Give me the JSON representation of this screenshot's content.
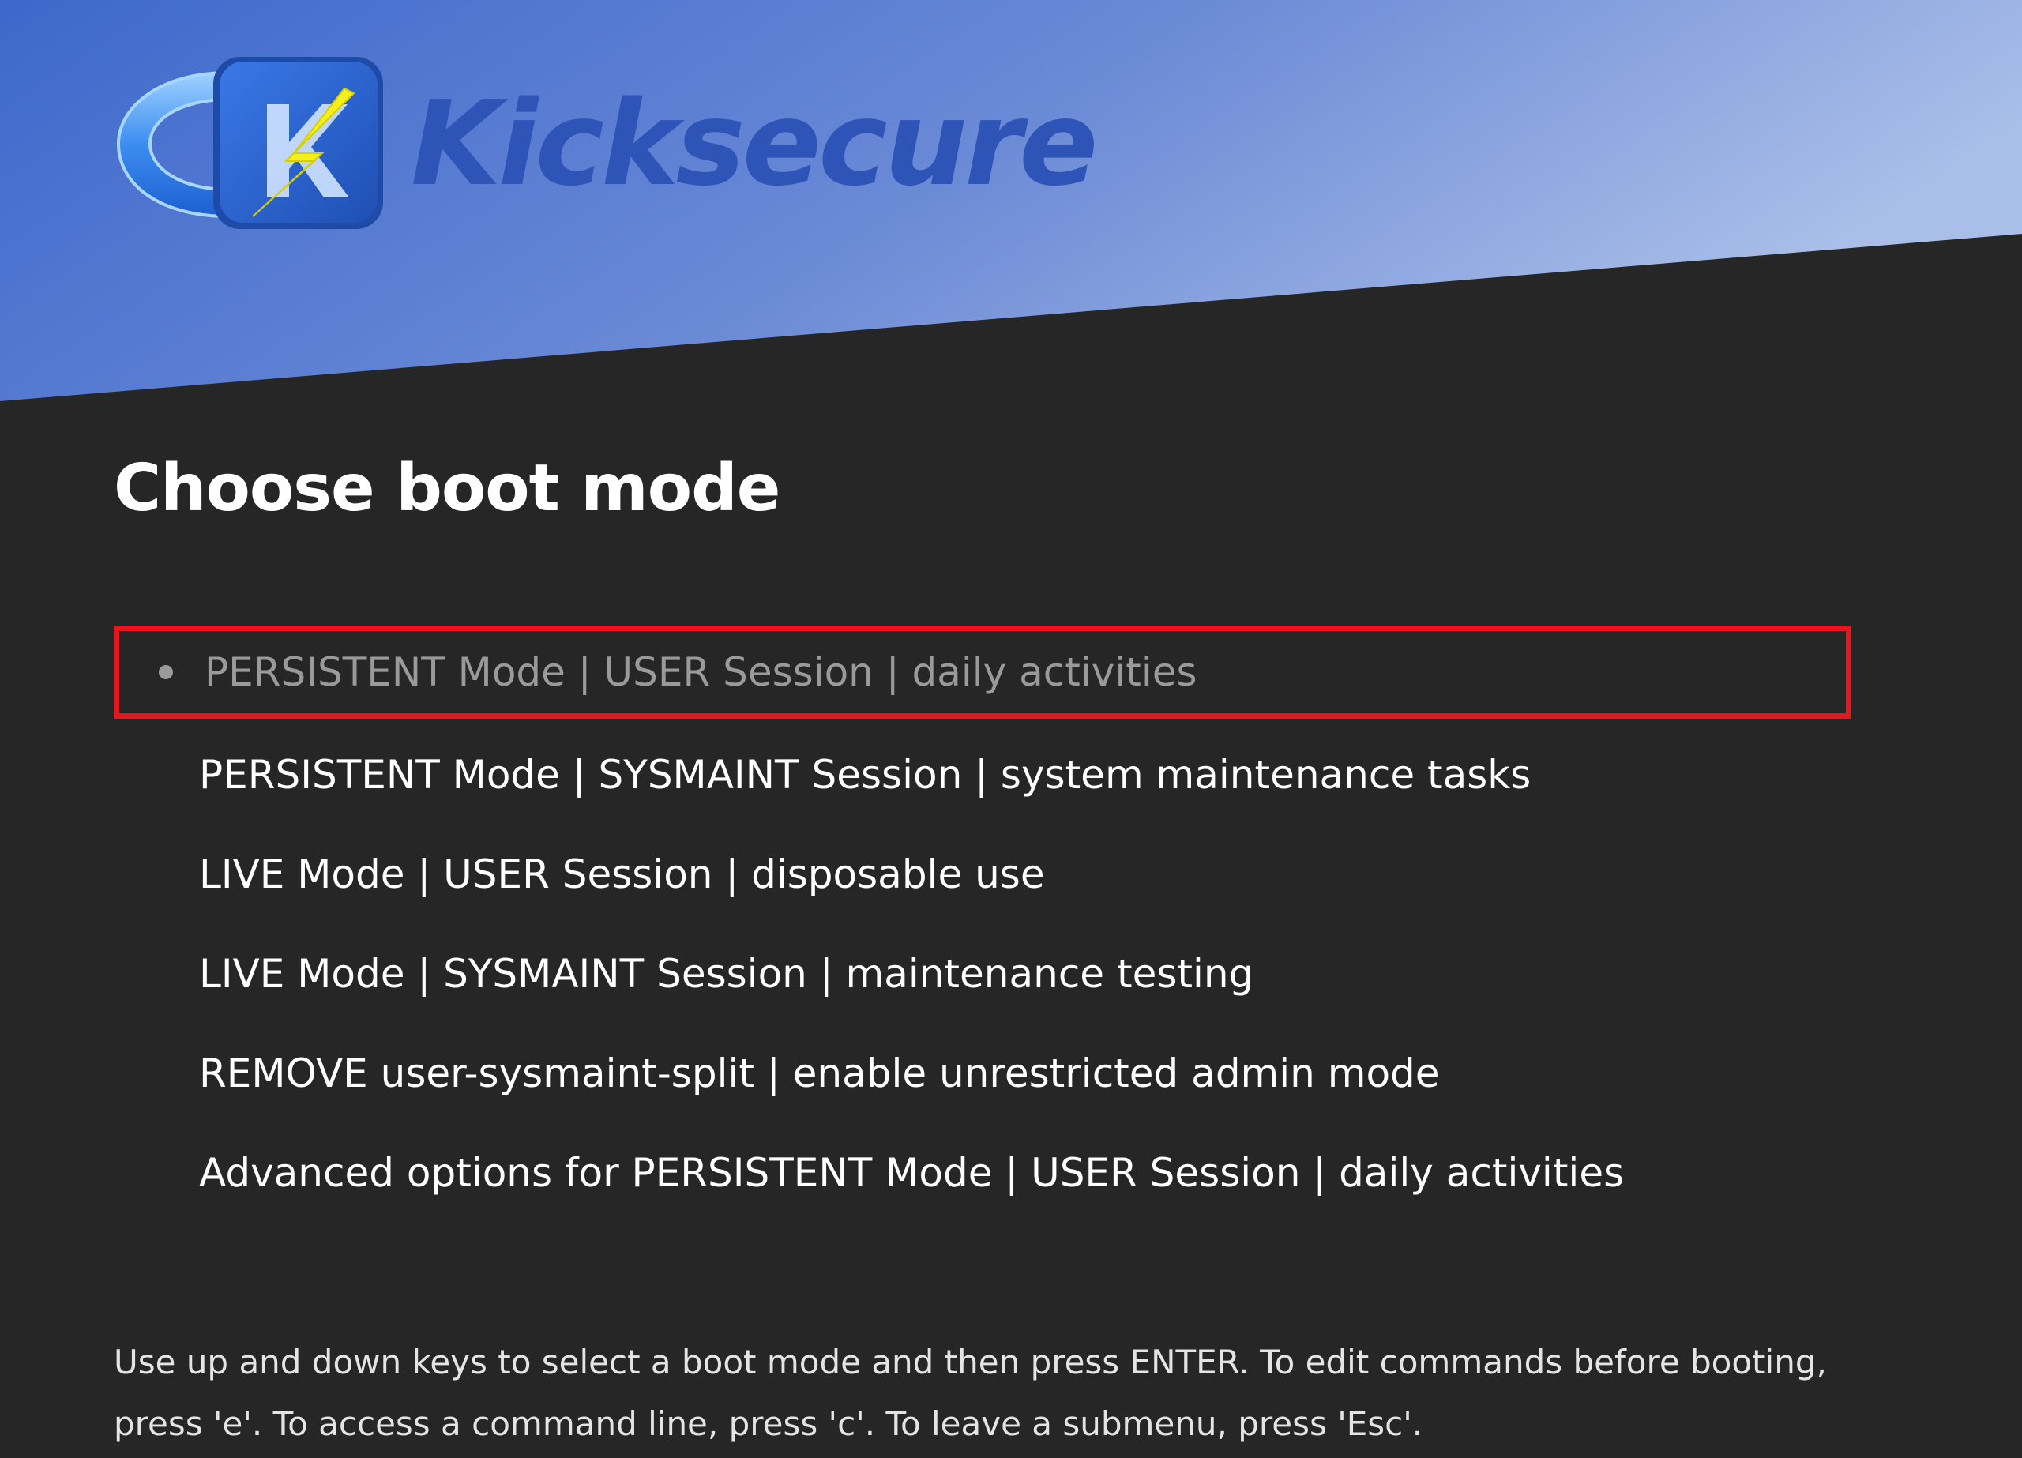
{
  "brand": {
    "name": "Kicksecure",
    "logo_icon": "kicksecure-logo-icon"
  },
  "title": "Choose boot mode",
  "menu": {
    "items": [
      {
        "label": "PERSISTENT Mode | USER Session | daily activities",
        "selected": true
      },
      {
        "label": "PERSISTENT Mode | SYSMAINT Session | system maintenance tasks",
        "selected": false
      },
      {
        "label": "LIVE Mode | USER Session | disposable use",
        "selected": false
      },
      {
        "label": "LIVE Mode | SYSMAINT Session | maintenance testing",
        "selected": false
      },
      {
        "label": "REMOVE user-sysmaint-split | enable unrestricted admin mode",
        "selected": false
      },
      {
        "label": "Advanced options for PERSISTENT Mode | USER Session | daily activities",
        "selected": false
      }
    ]
  },
  "help": {
    "line1": "Use up and down keys to select a boot mode and then press ENTER. To edit commands before booting,",
    "line2": "press 'e'. To access a command line, press 'c'. To leave a submenu, press 'Esc'."
  },
  "colors": {
    "background": "#262626",
    "banner_gradient_start": "#3d68cc",
    "banner_gradient_end": "#a6bce6",
    "brand_text": "#2f54b8",
    "selection_border": "#e3181e",
    "selected_text": "#9a9a9a",
    "logo_bolt": "#f5ef1c"
  }
}
